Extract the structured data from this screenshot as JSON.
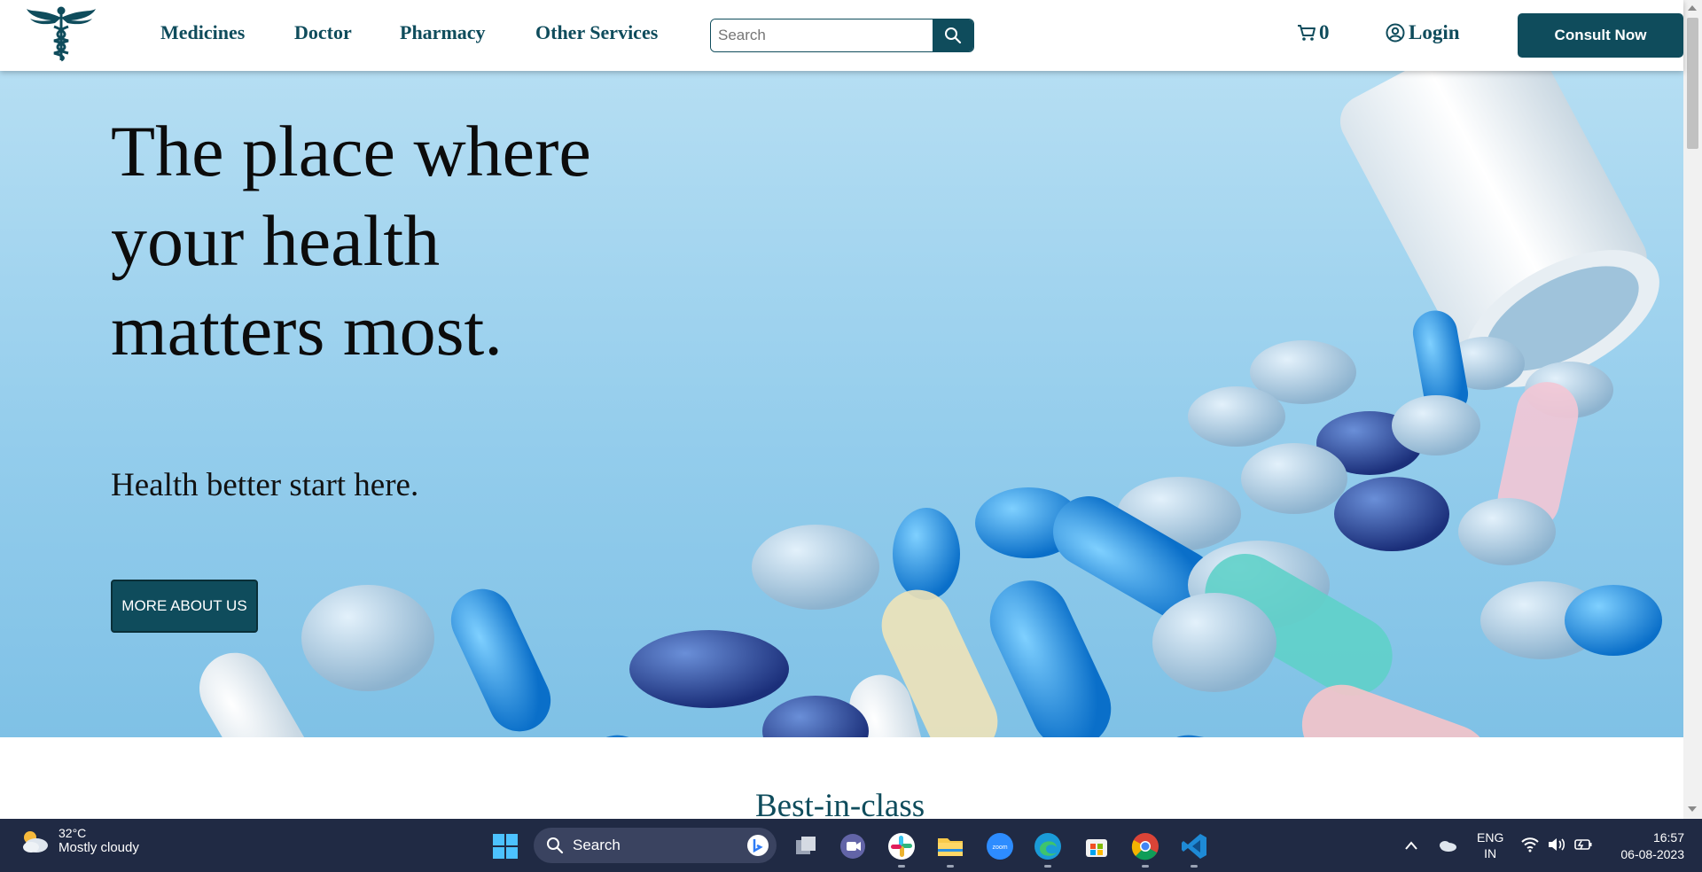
{
  "nav": {
    "links": [
      "Medicines",
      "Doctor",
      "Pharmacy",
      "Other Services"
    ],
    "search_placeholder": "Search",
    "cart_count": "0",
    "login_label": "Login",
    "consult_label": "Consult Now"
  },
  "hero": {
    "title": "The place where your health matters most.",
    "subtitle": "Health better start here.",
    "button_label": "MORE ABOUT US"
  },
  "section": {
    "heading": "Best-in-class"
  },
  "taskbar": {
    "weather_temp": "32°C",
    "weather_condition": "Mostly cloudy",
    "search_label": "Search",
    "language": "ENG",
    "region": "IN",
    "time": "16:57",
    "date": "06-08-2023",
    "apps": [
      "task-view-icon",
      "teams-icon",
      "slack-icon",
      "file-explorer-icon",
      "zoom-icon",
      "edge-icon",
      "store-icon",
      "chrome-icon",
      "vscode-icon"
    ]
  },
  "colors": {
    "brand": "#0f4c5c",
    "taskbar": "#202a44"
  }
}
